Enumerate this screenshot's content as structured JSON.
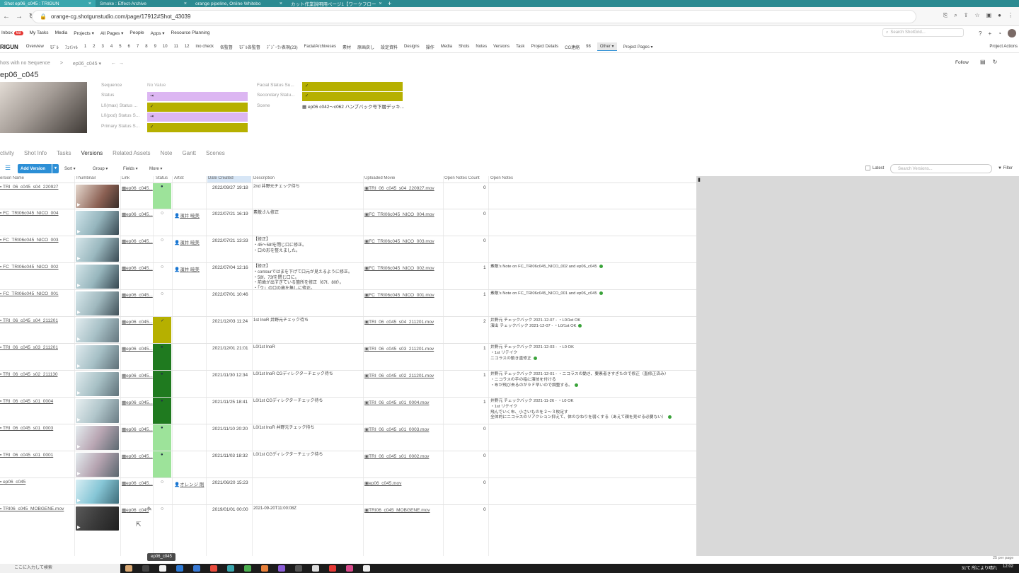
{
  "browser": {
    "tabs": [
      {
        "label": "Shot ep06_c045 : TRIGUN",
        "active": true
      },
      {
        "label": "Smoke : Effect-Archive",
        "active": false
      },
      {
        "label": "orange pipeline, Online Whitebo",
        "active": false
      },
      {
        "label": "カット作業説明用ページ1【ワークフロー",
        "active": false
      }
    ],
    "url": "orange-cg.shotgunstudio.com/page/17912#Shot_43039"
  },
  "globalnav": {
    "inbox_label": "Inbox",
    "inbox_count": "68",
    "items": [
      "My Tasks",
      "Media",
      "Projects ▾",
      "All Pages ▾",
      "People",
      "Apps ▾",
      "Resource Planning"
    ],
    "search_placeholder": "Search ShotGrid..."
  },
  "projectnav": {
    "project": "RIGUN",
    "items": [
      "Overview",
      "ﾓﾃﾞﾙ",
      "ﾌｪｲｼｬﾙ",
      "1",
      "2",
      "3",
      "4",
      "5",
      "6",
      "7",
      "8",
      "9",
      "10",
      "11",
      "12",
      "ino check",
      "各監督",
      "ﾓﾃﾞﾙ各監督",
      "ﾃﾞｼﾞｰﾗﾝ表現(23)",
      "FacialArchiveses",
      "素材",
      "原画戻し",
      "設定資料",
      "Designs",
      "操作",
      "Media",
      "Shots",
      "Notes",
      "Versions",
      "Task",
      "Project Details",
      "CG連絡",
      "98"
    ],
    "active_item": "Other ▾",
    "pages": "Project Pages ▾",
    "actions": "Project Actions"
  },
  "header": {
    "crumb_root": "hots with no Sequence",
    "crumb_sep": ">",
    "crumb_current": "ep06_c045 ▾",
    "title": "ep06_c045",
    "follow": "Follow"
  },
  "fields": {
    "sequence_label": "Sequence",
    "sequence_value": "No Value",
    "status_label": "Status",
    "lo_max_label": "L0(max) Status ...",
    "lo_pod_label": "L0(pod) Status S...",
    "primary_label": "Primary Status S...",
    "facial_label": "Facial Status Su...",
    "secondary_label": "Secondary Statu...",
    "scene_label": "Scene",
    "scene_value": "ep06 c042〜c062 ハンブバック号下層デッキ..."
  },
  "detail_tabs": [
    "ctivity",
    "Shot Info",
    "Tasks",
    "Versions",
    "Related Assets",
    "Note",
    "Gantt",
    "Scenes"
  ],
  "detail_tab_active": "Versions",
  "toolbar": {
    "add_version": "Add Version",
    "sort": "Sort ▾",
    "group": "Group ▾",
    "fields": "Fields ▾",
    "more": "More ▾",
    "latest": "Latest",
    "search_placeholder": "Search Versions...",
    "filter": "Filter"
  },
  "columns": [
    "ersion Name",
    "Thumbnail",
    "Link",
    "Status",
    "Artist",
    "Date Created",
    "Description",
    "Uploaded Movie",
    "Open Notes Count",
    "Open Notes"
  ],
  "rows": [
    {
      "name": "TRI_06_c045_s04_220927",
      "link": "ep06_c045...",
      "status": "lightgreen",
      "artist": "",
      "date": "2022/09/27 19:18",
      "desc": "2nd 井野元チェック待ち",
      "movie": "TRI_06_c045_s04_220927.mov",
      "count": "0",
      "notes": ""
    },
    {
      "name": "FC_TRI06c045_NICO_004",
      "link": "ep06_c045...",
      "status": "none",
      "artist": "濱井 暁美",
      "date": "2022/07/21 16:19",
      "desc": "素敵さん修正",
      "movie": "FC_TRI06c045_NICO_004.mov",
      "count": "0",
      "notes": ""
    },
    {
      "name": "FC_TRI06c045_NICO_003",
      "link": "ep06_c045...",
      "status": "none",
      "artist": "濱井 暁美",
      "date": "2022/07/21 13:33",
      "desc": "【修正】\n・45〜58fを閉じ口に修正。\n・口の形を整えました。",
      "movie": "FC_TRI06c045_NICO_003.mov",
      "count": "0",
      "notes": ""
    },
    {
      "name": "FC_TRI06c045_NICO_002",
      "link": "ep06_c045...",
      "status": "none",
      "artist": "濱井 暁美",
      "date": "2022/07/04 12:16",
      "desc": "【修正】\n・contourではまを下げて口元が見えるように修正。\n・58f、73fを閉じ口に。\n・前歯が出すぎている箇所を修正（67f、80f）。\n・「ウ」の口の歯を無しに修正。",
      "movie": "FC_TRI06c045_NICO_002.mov",
      "count": "1",
      "notes": "素敵's Note on FC_TRI06c045_NICO_002 and ep06_c045"
    },
    {
      "name": "FC_TRI06c045_NICO_001",
      "link": "ep06_c045...",
      "status": "none",
      "artist": "",
      "date": "2022/07/01 10:46",
      "desc": "",
      "movie": "FC_TRI06c045_NICO_001.mov",
      "count": "1",
      "notes": "素敵's Note on FC_TRI06c045_NICO_001 and ep06_c045"
    },
    {
      "name": "TRI_06_c045_s04_211201",
      "link": "ep06_c045...",
      "status": "olive",
      "artist": "",
      "date": "2021/12/03 11:24",
      "desc": "1st InoR 井野元チェック待ち",
      "movie": "TRI_06_c045_s04_211201.mov",
      "count": "2",
      "notes": "井野元 チェックバック 2021-12-07 - ・L0/1st OK\n演出 チェックバック 2021-12-07 - ・L0/1st OK"
    },
    {
      "name": "TRI_06_c045_s03_211201",
      "link": "ep06_c045...",
      "status": "darkgreen",
      "artist": "",
      "date": "2021/12/01 21:01",
      "desc": "L0/1st InoR",
      "movie": "TRI_06_c045_s03_211201.mov",
      "count": "1",
      "notes": "井野元 チェックバック 2021-12-03 - ・L0 OK\n・1st リテイク\nニコラスの動き直修正"
    },
    {
      "name": "TRI_06_c045_s02_211130",
      "link": "ep06_c045...",
      "status": "darkgreen",
      "artist": "",
      "date": "2021/11/30 12:34",
      "desc": "L0/1st InoR CGディレクターチェック待ち",
      "movie": "TRI_06_c045_s02_211201.mov",
      "count": "1",
      "notes": "井野元 チェックバック 2021-12-01 - ・ニコラスの動き、要素者きすぎたので修正（直修正済み）\n・ニコラスの手の指に演技を付ける\n・布が飛び去るのが９Ｆ早いので調整する。"
    },
    {
      "name": "TRI_06_c045_s01_0004",
      "link": "ep06_c045...",
      "status": "darkgreen",
      "artist": "",
      "date": "2021/11/25 18:41",
      "desc": "L0/1st CGディレクターチェック待ち",
      "movie": "TRI_06_c045_s01_0004.mov",
      "count": "1",
      "notes": "井野元 チェックバック 2021-11-26 - ・L0 OK\n・1st リテイク\n飛んでいく布、小さいものを２〜３枚足す\n全体的にニコラスのリアクション抑えて、体のひねりを弱くする（あえて顔を見せる必要ない）"
    },
    {
      "name": "TRI_06_c045_s01_0003",
      "link": "ep06_c045...",
      "status": "lightgreen",
      "artist": "",
      "date": "2021/11/10 20:20",
      "desc": "L0/1st InoR 井野元チェック待ち",
      "movie": "TRI_06_c045_s01_0003.mov",
      "count": "0",
      "notes": ""
    },
    {
      "name": "TRI_06_c045_s01_0001",
      "link": "ep06_c045...",
      "status": "lightgreen",
      "artist": "",
      "date": "2021/11/03 18:32",
      "desc": "L0/1st CGディレクターチェック待ち",
      "movie": "TRI_06_c045_s01_0002.mov",
      "count": "0",
      "notes": ""
    },
    {
      "name": "ep06_c045",
      "link": "ep06_c045...",
      "status": "none",
      "artist": "オレンジ 剛",
      "date": "2021/06/20 15:23",
      "desc": "",
      "movie": "ep06_c045.mov",
      "count": "0",
      "notes": ""
    },
    {
      "name": "TRI06_c045_MOBGENE.mov",
      "link": "ep06_c045",
      "status": "none",
      "artist": "",
      "date": "2019/01/01 00:00",
      "desc": "2021-09-20T11:00:08Z",
      "movie": "TRI06_c045_MOBGENE.mov",
      "count": "0",
      "notes": ""
    }
  ],
  "tooltip": "ep06_c045",
  "per_page": "25 per page",
  "taskbar": {
    "search_placeholder": "ここに入力して検索",
    "weather": "31℃ 所により晴れ",
    "clock": "12:02"
  },
  "colors": {
    "accent": "#2c8fd6",
    "lightgreen": "#9de39a",
    "darkgreen": "#1f7a1f",
    "olive": "#b6b000",
    "lavender": "#dcb6f2"
  }
}
